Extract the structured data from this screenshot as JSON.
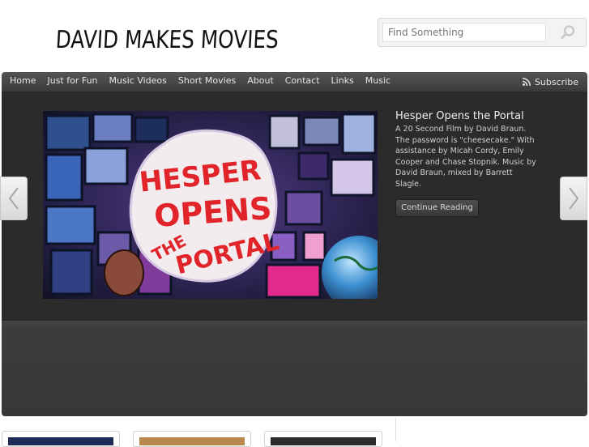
{
  "site": {
    "logo_text": "DAVID MAKES MOVIES"
  },
  "search": {
    "placeholder": "Find Something",
    "icon": "search-icon"
  },
  "nav": {
    "items": [
      "Home",
      "Just for Fun",
      "Music Videos",
      "Short Movies",
      "About",
      "Contact",
      "Links",
      "Music"
    ],
    "subscribe_label": "Subscribe",
    "subscribe_icon": "rss-icon"
  },
  "slider": {
    "image_text": [
      "HESPER",
      "OPENS",
      "THE",
      "PORTAL"
    ],
    "title": "Hesper Opens the Portal",
    "description": "A 20 Second Film by David Braun. The password is \"cheesecake.\" With assistance by Micah Cordy, Emily Cooper and Chase Stopnik. Music by David Braun, mixed by Barrett Slagle.",
    "continue_label": "Continue Reading",
    "prev_icon": "chevron-left-icon",
    "next_icon": "chevron-right-icon"
  },
  "colors": {
    "nav_bg": "#444444",
    "slider_bg": "#2b2b2b",
    "accent_red": "#e0242a"
  }
}
